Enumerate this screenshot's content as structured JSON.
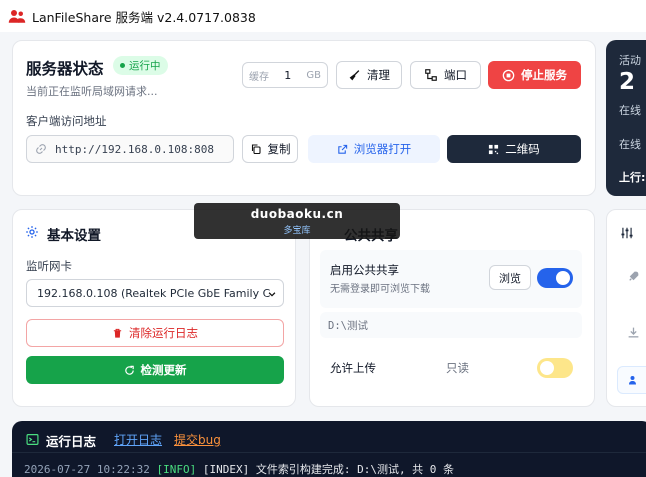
{
  "window": {
    "title": "LanFileShare 服务端 v2.4.0717.0838"
  },
  "status": {
    "title": "服务器状态",
    "badge": "运行中",
    "subtitle": "当前正在监听局域网请求...",
    "cache_label": "缓存",
    "cache_value": "1",
    "cache_unit": "GB",
    "clear_label": "清理",
    "port_label": "端口",
    "stop_label": "停止服务",
    "url_label": "客户端访问地址",
    "url": "http://192.168.0.108:808",
    "copy_label": "复制",
    "browser_label": "浏览器打开",
    "qrcode_label": "二维码"
  },
  "side_stats": {
    "active_label": "活动",
    "active_count": "2",
    "online_label": "在线",
    "online_duration_label": "在线",
    "upload_label": "上行:"
  },
  "settings": {
    "title": "基本设置",
    "nic_label": "监听网卡",
    "nic_value": "192.168.0.108 (Realtek PCIe GbE Family C",
    "clear_log_label": "清除运行日志",
    "check_update_label": "检测更新"
  },
  "share": {
    "title": "公共共享",
    "enable_label": "启用公共共享",
    "enable_desc": "无需登录即可浏览下载",
    "browse_label": "浏览",
    "enable_on": true,
    "path": "D:\\测试",
    "upload_label": "允许上传",
    "readonly_label": "只读",
    "upload_on": false
  },
  "log": {
    "title": "运行日志",
    "open_log_label": "打开日志",
    "report_bug_label": "提交bug",
    "line_time": "2026-07-27 10:22:32",
    "line_level": "[INFO]",
    "line_tag": "[INDEX]",
    "line_msg": "文件索引构建完成: D:\\测试, 共 0 条"
  },
  "watermark": {
    "main": "duobaoku.cn",
    "sub": "多宝库"
  },
  "colors": {
    "accent": "#2563eb",
    "stop": "#ef4444",
    "success": "#16a34a",
    "dark": "#1e293b"
  }
}
